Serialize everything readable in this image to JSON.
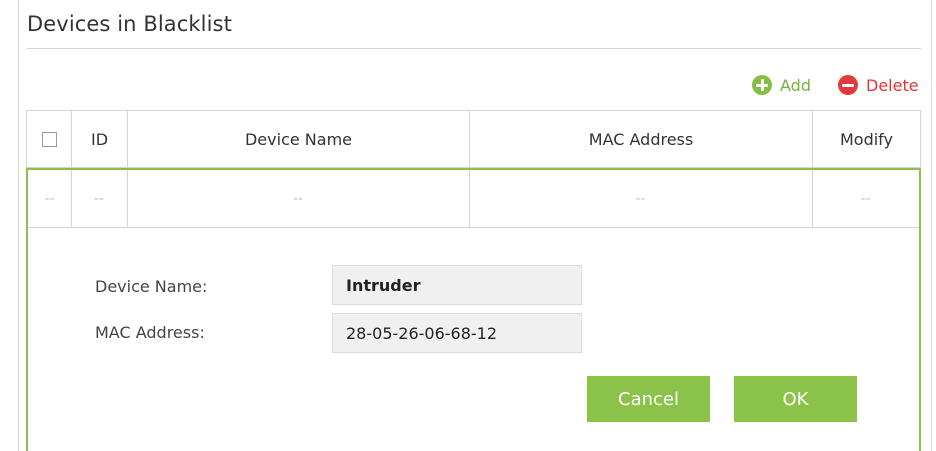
{
  "section": {
    "title": "Devices in Blacklist"
  },
  "toolbar": {
    "add_label": "Add",
    "delete_label": "Delete",
    "add_icon": "plus-circle-icon",
    "delete_icon": "minus-circle-icon"
  },
  "table": {
    "columns": [
      "",
      "ID",
      "Device Name",
      "MAC Address",
      "Modify"
    ],
    "editing_row": [
      "--",
      "--",
      "--",
      "--",
      "--"
    ]
  },
  "form": {
    "device_name_label": "Device Name:",
    "device_name_value": "Intruder",
    "mac_address_label": "MAC Address:",
    "mac_address_value": "28-05-26-06-68-12",
    "cancel_label": "Cancel",
    "ok_label": "OK"
  },
  "colors": {
    "accent_green": "#8bc34a",
    "delete_red": "#e33a3f"
  }
}
